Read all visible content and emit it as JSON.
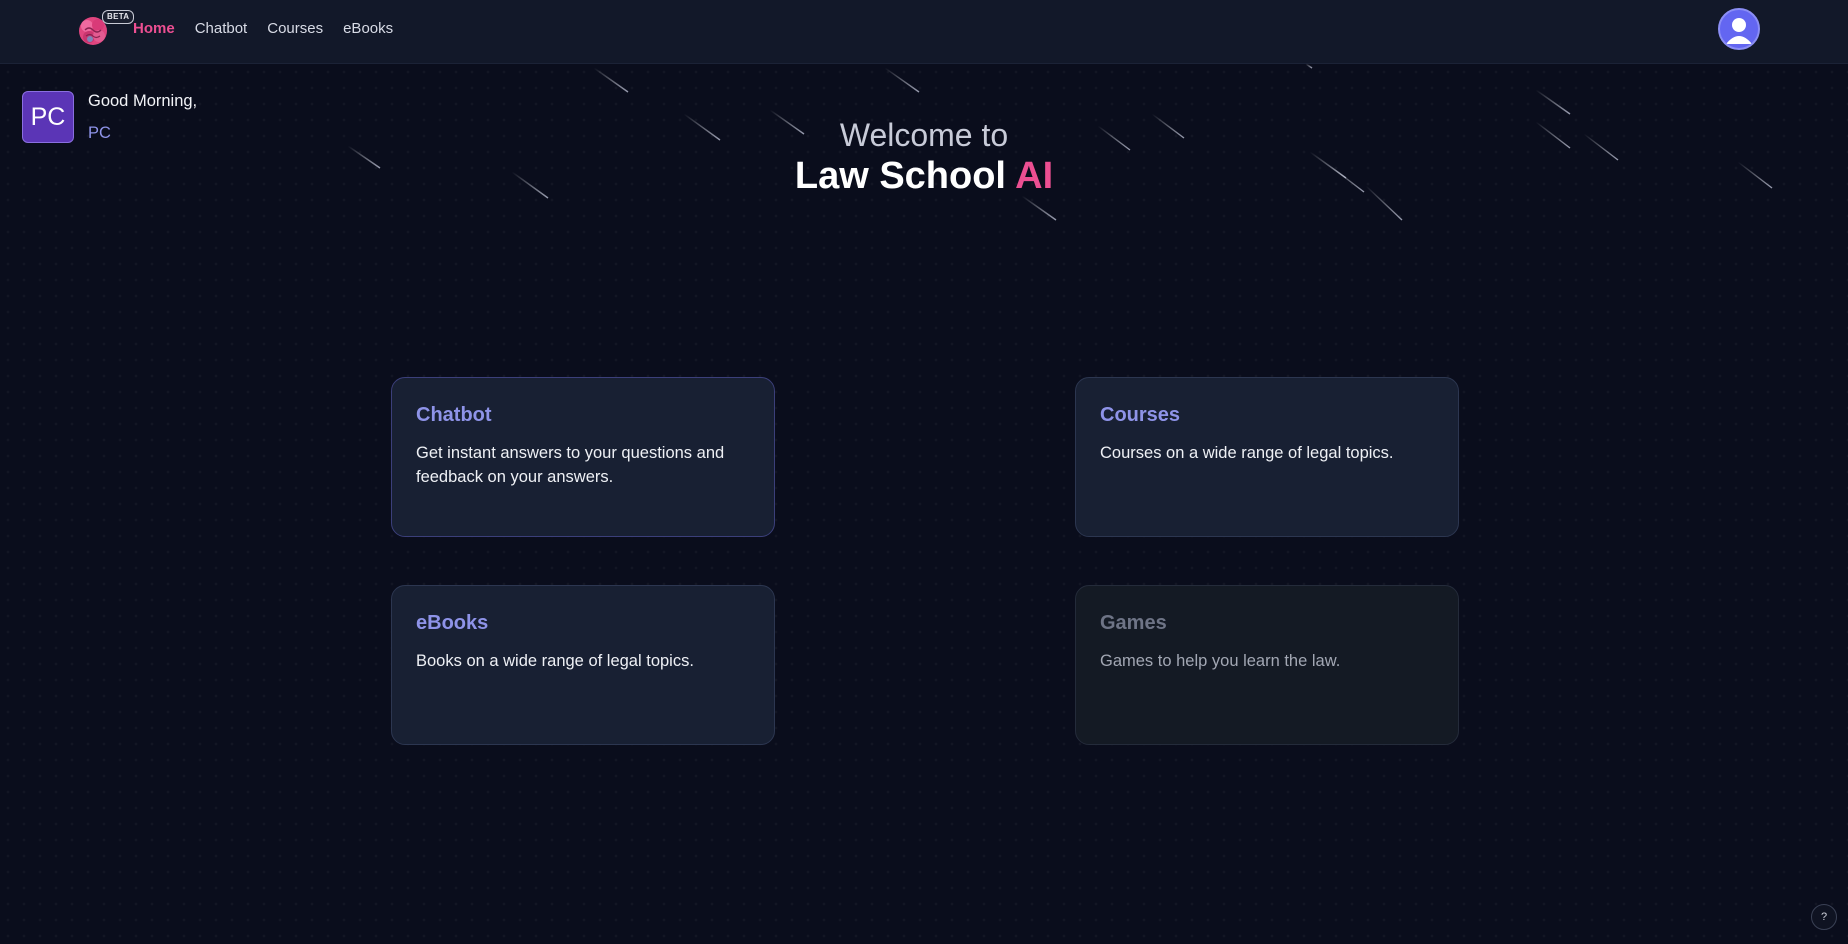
{
  "nav": {
    "beta_badge": "BETA",
    "items": [
      {
        "label": "Home",
        "active": true
      },
      {
        "label": "Chatbot",
        "active": false
      },
      {
        "label": "Courses",
        "active": false
      },
      {
        "label": "eBooks",
        "active": false
      }
    ]
  },
  "profile": {
    "icon": "user-avatar-icon"
  },
  "greeting": {
    "initials": "PC",
    "text": "Good Morning,",
    "name": "PC"
  },
  "hero": {
    "line1": "Welcome to",
    "line2_main": "Law School ",
    "line2_accent": "AI"
  },
  "cards": [
    {
      "title": "Chatbot",
      "description": "Get instant answers to your questions and feedback on your answers."
    },
    {
      "title": "Courses",
      "description": "Courses on a wide range of legal topics."
    },
    {
      "title": "eBooks",
      "description": "Books on a wide range of legal topics."
    },
    {
      "title": "Games",
      "description": "Games to help you learn the law."
    }
  ],
  "help": {
    "label": "?"
  },
  "colors": {
    "accent_pink": "#ec4f92",
    "accent_indigo": "#8e93e8",
    "background": "#0a0d1c",
    "card": "#182033",
    "avatar": "#5b35b6"
  }
}
